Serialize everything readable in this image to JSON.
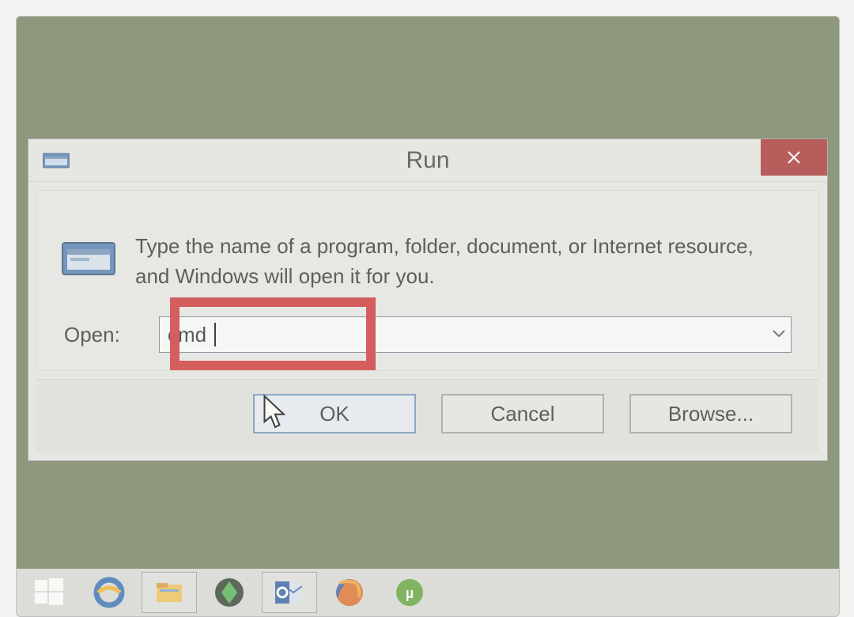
{
  "dialog": {
    "title": "Run",
    "instruction": "Type the name of a program, folder, document, or Internet resource, and Windows will open it for you.",
    "open_label": "Open:",
    "open_value": "cmd",
    "close_symbol": "×",
    "buttons": {
      "ok": "OK",
      "cancel": "Cancel",
      "browse": "Browse..."
    }
  },
  "taskbar": {
    "items": [
      "start",
      "ie",
      "explorer",
      "sims",
      "outlook",
      "firefox",
      "utorrent"
    ]
  },
  "colors": {
    "desktop": "#6d7a55",
    "highlight": "#cc2a2a",
    "close": "#a52a2a"
  }
}
